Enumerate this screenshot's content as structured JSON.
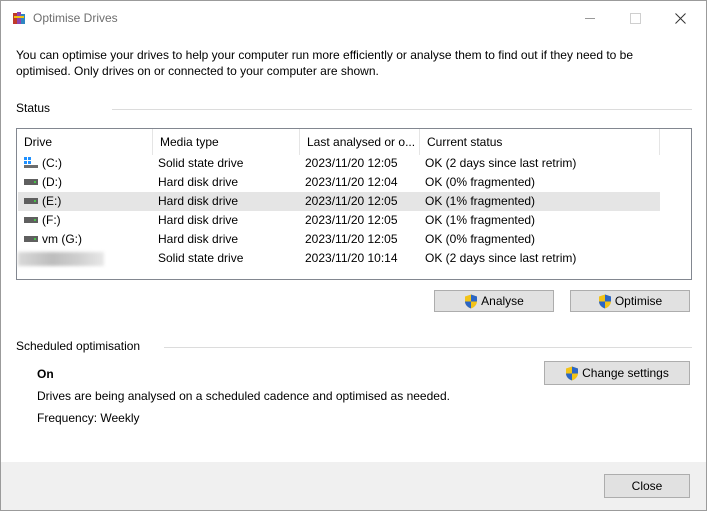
{
  "window": {
    "title": "Optimise Drives"
  },
  "intro": "You can optimise your drives to help your computer run more efficiently or analyse them to find out if they need to be optimised. Only drives on or connected to your computer are shown.",
  "status": {
    "label": "Status",
    "columns": [
      "Drive",
      "Media type",
      "Last analysed or o...",
      "Current status"
    ],
    "rows": [
      {
        "drive": "(C:)",
        "media": "Solid state drive",
        "last": "2023/11/20 12:05",
        "status": "OK (2 days since last retrim)",
        "icon": "windows-drive-icon"
      },
      {
        "drive": "(D:)",
        "media": "Hard disk drive",
        "last": "2023/11/20 12:04",
        "status": "OK (0% fragmented)",
        "icon": "hard-drive-icon"
      },
      {
        "drive": "(E:)",
        "media": "Hard disk drive",
        "last": "2023/11/20 12:05",
        "status": "OK (1% fragmented)",
        "icon": "hard-drive-icon",
        "selected": true
      },
      {
        "drive": "(F:)",
        "media": "Hard disk drive",
        "last": "2023/11/20 12:05",
        "status": "OK (1% fragmented)",
        "icon": "hard-drive-icon"
      },
      {
        "drive": "vm (G:)",
        "media": "Hard disk drive",
        "last": "2023/11/20 12:05",
        "status": "OK (0% fragmented)",
        "icon": "hard-drive-icon"
      },
      {
        "drive": "",
        "media": "Solid state drive",
        "last": "2023/11/20 10:14",
        "status": "OK (2 days since last retrim)",
        "icon": "redacted-drive-name"
      }
    ]
  },
  "buttons": {
    "analyse": "Analyse",
    "optimise": "Optimise",
    "change_settings": "Change settings",
    "close": "Close"
  },
  "scheduled": {
    "label": "Scheduled optimisation",
    "state": "On",
    "description": "Drives are being analysed on a scheduled cadence and optimised as needed.",
    "frequency": "Frequency: Weekly"
  },
  "colors": {
    "shield_blue": "#2b66c6",
    "shield_yellow": "#f2c318",
    "selected_row": "#e5e5e5"
  }
}
